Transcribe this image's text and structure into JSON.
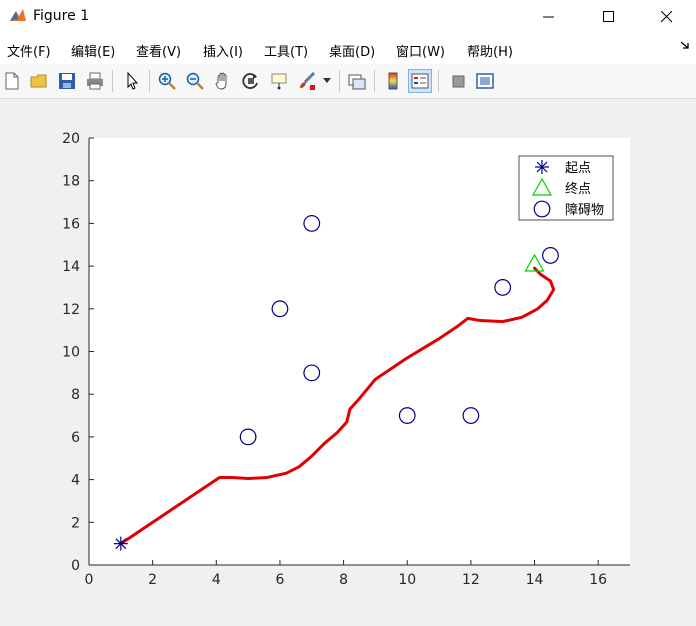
{
  "window": {
    "title": "Figure 1",
    "minimize_icon": "minimize-icon",
    "maximize_icon": "maximize-icon",
    "close_icon": "close-icon"
  },
  "menu": [
    "文件(F)",
    "编辑(E)",
    "查看(V)",
    "插入(I)",
    "工具(T)",
    "桌面(D)",
    "窗口(W)",
    "帮助(H)"
  ],
  "toolbar": [
    "new-figure-icon",
    "open-file-icon",
    "save-icon",
    "print-icon",
    "pointer-icon",
    "zoom-in-icon",
    "zoom-out-icon",
    "pan-icon",
    "rotate-3d-icon",
    "data-cursor-icon",
    "brush-icon",
    "link-plot-icon",
    "colorbar-icon",
    "legend-icon",
    "hide-plot-tools-icon",
    "show-plot-tools-icon"
  ],
  "chart_data": {
    "type": "scatter",
    "xlim": [
      0,
      17
    ],
    "ylim": [
      0,
      20
    ],
    "xticks": [
      "0",
      "2",
      "4",
      "6",
      "8",
      "10",
      "12",
      "14",
      "16"
    ],
    "yticks": [
      "0",
      "2",
      "4",
      "6",
      "8",
      "10",
      "12",
      "14",
      "16",
      "18",
      "20"
    ],
    "grid": false,
    "legend_position": "top-right",
    "series": [
      {
        "name": "起点",
        "marker": "asterisk",
        "color": "#000080",
        "points": [
          [
            1,
            1
          ]
        ]
      },
      {
        "name": "终点",
        "marker": "triangle",
        "color": "#00d000",
        "points": [
          [
            14,
            14.1
          ]
        ]
      },
      {
        "name": "障碍物",
        "marker": "circle",
        "color": "#000080",
        "points": [
          [
            5,
            6
          ],
          [
            6,
            12
          ],
          [
            7,
            16
          ],
          [
            7,
            9
          ],
          [
            10,
            7
          ],
          [
            12,
            7
          ],
          [
            13,
            13
          ],
          [
            14.5,
            14.5
          ]
        ]
      }
    ],
    "path": {
      "color": "#e00000",
      "points": [
        [
          1,
          1
        ],
        [
          4.1,
          4.1
        ],
        [
          4.5,
          4.1
        ],
        [
          5,
          4.05
        ],
        [
          5.6,
          4.1
        ],
        [
          6.2,
          4.3
        ],
        [
          6.6,
          4.6
        ],
        [
          7,
          5.1
        ],
        [
          7.4,
          5.7
        ],
        [
          7.8,
          6.2
        ],
        [
          8.1,
          6.7
        ],
        [
          8.2,
          7.3
        ],
        [
          8.5,
          7.8
        ],
        [
          9,
          8.7
        ],
        [
          10,
          9.7
        ],
        [
          11,
          10.6
        ],
        [
          11.6,
          11.2
        ],
        [
          11.9,
          11.55
        ],
        [
          12.3,
          11.45
        ],
        [
          13,
          11.4
        ],
        [
          13.6,
          11.6
        ],
        [
          14.1,
          12.0
        ],
        [
          14.4,
          12.4
        ],
        [
          14.6,
          12.9
        ],
        [
          14.5,
          13.3
        ],
        [
          14.2,
          13.6
        ],
        [
          14,
          13.9
        ]
      ]
    }
  }
}
